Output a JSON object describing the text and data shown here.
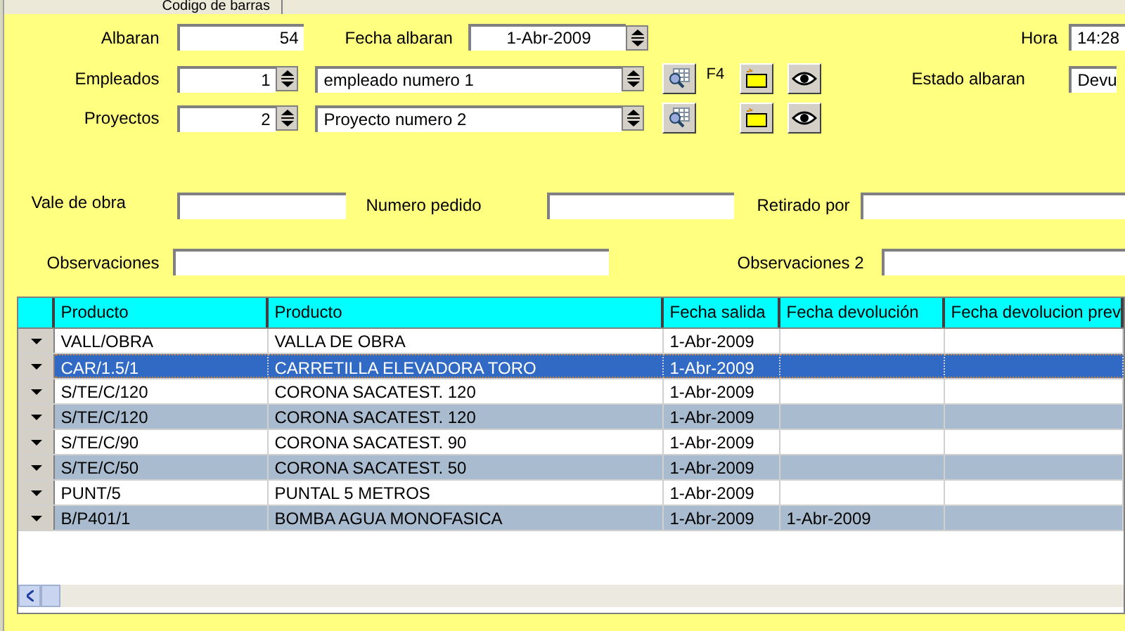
{
  "tabs": [
    {
      "label": "Codigo de barras",
      "selected": false
    }
  ],
  "header": {
    "albaran": {
      "label": "Albaran",
      "value": "54"
    },
    "fecha_albaran": {
      "label": "Fecha albaran",
      "value": "1-Abr-2009"
    },
    "hora": {
      "label": "Hora",
      "value": "14:28"
    },
    "empleados": {
      "label": "Empleados",
      "code": "1",
      "name": "empleado numero 1",
      "shortcut": "F4"
    },
    "proyectos": {
      "label": "Proyectos",
      "code": "2",
      "name": "Proyecto numero 2"
    },
    "estado_albaran": {
      "label": "Estado albaran",
      "value": "Devu"
    }
  },
  "extra_fields": [
    {
      "label": "Vale de obra"
    },
    {
      "label": "Numero pedido"
    },
    {
      "label": "Retirado por"
    },
    {
      "label": "Observaciones"
    },
    {
      "label": "Observaciones 2"
    }
  ],
  "table": {
    "columns": [
      "Producto",
      "Producto",
      "Fecha salida",
      "Fecha devolución",
      "Fecha devolucion prev"
    ],
    "rows": [
      {
        "cells": [
          "VALL/OBRA",
          "VALLA DE OBRA",
          "1-Abr-2009"
        ],
        "selected": false
      },
      {
        "cells": [
          "CAR/1.5/1",
          "CARRETILLA ELEVADORA TORO",
          "1-Abr-2009"
        ],
        "selected": true
      },
      {
        "cells": [
          "S/TE/C/120",
          "CORONA SACATEST. 120",
          "1-Abr-2009"
        ],
        "selected": false
      },
      {
        "cells": [
          "S/TE/C/120",
          "CORONA SACATEST. 120",
          "1-Abr-2009"
        ],
        "selected": false
      },
      {
        "cells": [
          "S/TE/C/90",
          "CORONA SACATEST. 90",
          "1-Abr-2009"
        ],
        "selected": false
      },
      {
        "cells": [
          "S/TE/C/50",
          "CORONA SACATEST. 50",
          "1-Abr-2009"
        ],
        "selected": false
      },
      {
        "cells": [
          "PUNT/5",
          "PUNTAL 5 METROS",
          "1-Abr-2009"
        ],
        "selected": false
      },
      {
        "cells": [
          "B/P401/1",
          "BOMBA AGUA MONOFASICA",
          "1-Abr-2009",
          "1-Abr-2009"
        ],
        "selected": false
      }
    ]
  }
}
